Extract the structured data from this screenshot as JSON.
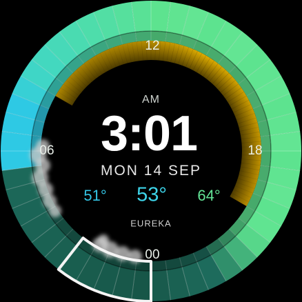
{
  "watchface": {
    "period": "AM",
    "time": "3:01",
    "date": "MON 14 SEP",
    "hour_labels": {
      "top": "12",
      "right": "18",
      "bottom": "00",
      "left": "06"
    },
    "weather": {
      "low": "51°",
      "current": "53°",
      "high": "64°",
      "location": "EUREKA"
    }
  },
  "colors": {
    "background": "#000000",
    "ring_green": "#5de38f",
    "ring_cyan": "#2ec9e4",
    "ring_teal": "#1d6b5c",
    "ring_dark_teal": "#175648",
    "sun_arc": "#e6b000",
    "temp_low": "#34c6e6",
    "temp_current": "#3dd3e8",
    "temp_high": "#63e496"
  }
}
